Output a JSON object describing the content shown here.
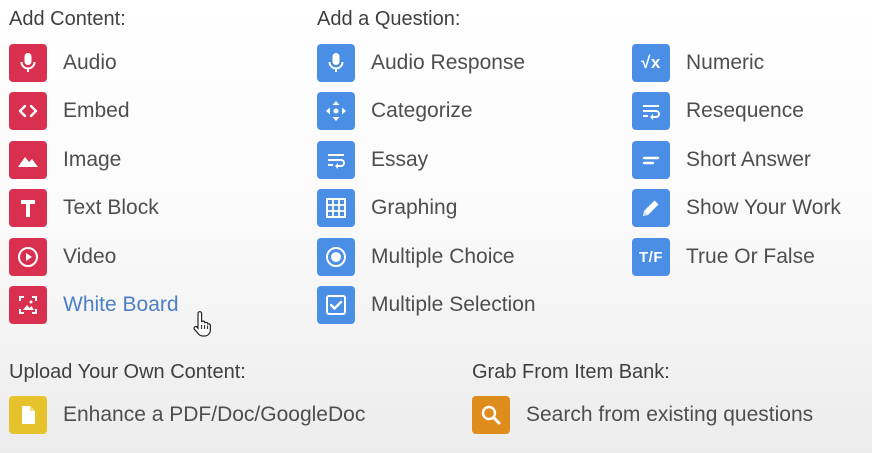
{
  "add_content": {
    "heading": "Add Content:",
    "items": [
      {
        "label": "Audio",
        "icon": "microphone-icon"
      },
      {
        "label": "Embed",
        "icon": "code-brackets-icon"
      },
      {
        "label": "Image",
        "icon": "mountain-image-icon"
      },
      {
        "label": "Text Block",
        "icon": "text-t-icon"
      },
      {
        "label": "Video",
        "icon": "play-circle-icon"
      },
      {
        "label": "White Board",
        "icon": "whiteboard-icon"
      }
    ]
  },
  "add_question": {
    "heading": "Add a Question:",
    "column1": [
      {
        "label": "Audio Response",
        "icon": "microphone-icon"
      },
      {
        "label": "Categorize",
        "icon": "four-arrows-icon"
      },
      {
        "label": "Essay",
        "icon": "wrap-text-icon"
      },
      {
        "label": "Graphing",
        "icon": "grid-icon"
      },
      {
        "label": "Multiple Choice",
        "icon": "radio-button-icon"
      },
      {
        "label": "Multiple Selection",
        "icon": "checkbox-icon"
      }
    ],
    "column2": [
      {
        "label": "Numeric",
        "icon": "square-root-icon",
        "glyph": "√x"
      },
      {
        "label": "Resequence",
        "icon": "wrap-text-icon"
      },
      {
        "label": "Short Answer",
        "icon": "short-lines-icon"
      },
      {
        "label": "Show Your Work",
        "icon": "pencil-icon"
      },
      {
        "label": "True Or False",
        "icon": "true-false-icon",
        "glyph": "T/F"
      }
    ]
  },
  "upload": {
    "heading": "Upload Your Own Content:",
    "item": {
      "label": "Enhance a PDF/Doc/GoogleDoc",
      "icon": "document-icon"
    }
  },
  "item_bank": {
    "heading": "Grab From Item Bank:",
    "item": {
      "label": "Search from existing questions",
      "icon": "search-icon"
    }
  },
  "colors": {
    "content": "#d9304f",
    "question": "#4a8ee6",
    "upload": "#e6c22c",
    "item_bank": "#de8c1c",
    "hover_label": "#4c7fc4"
  }
}
